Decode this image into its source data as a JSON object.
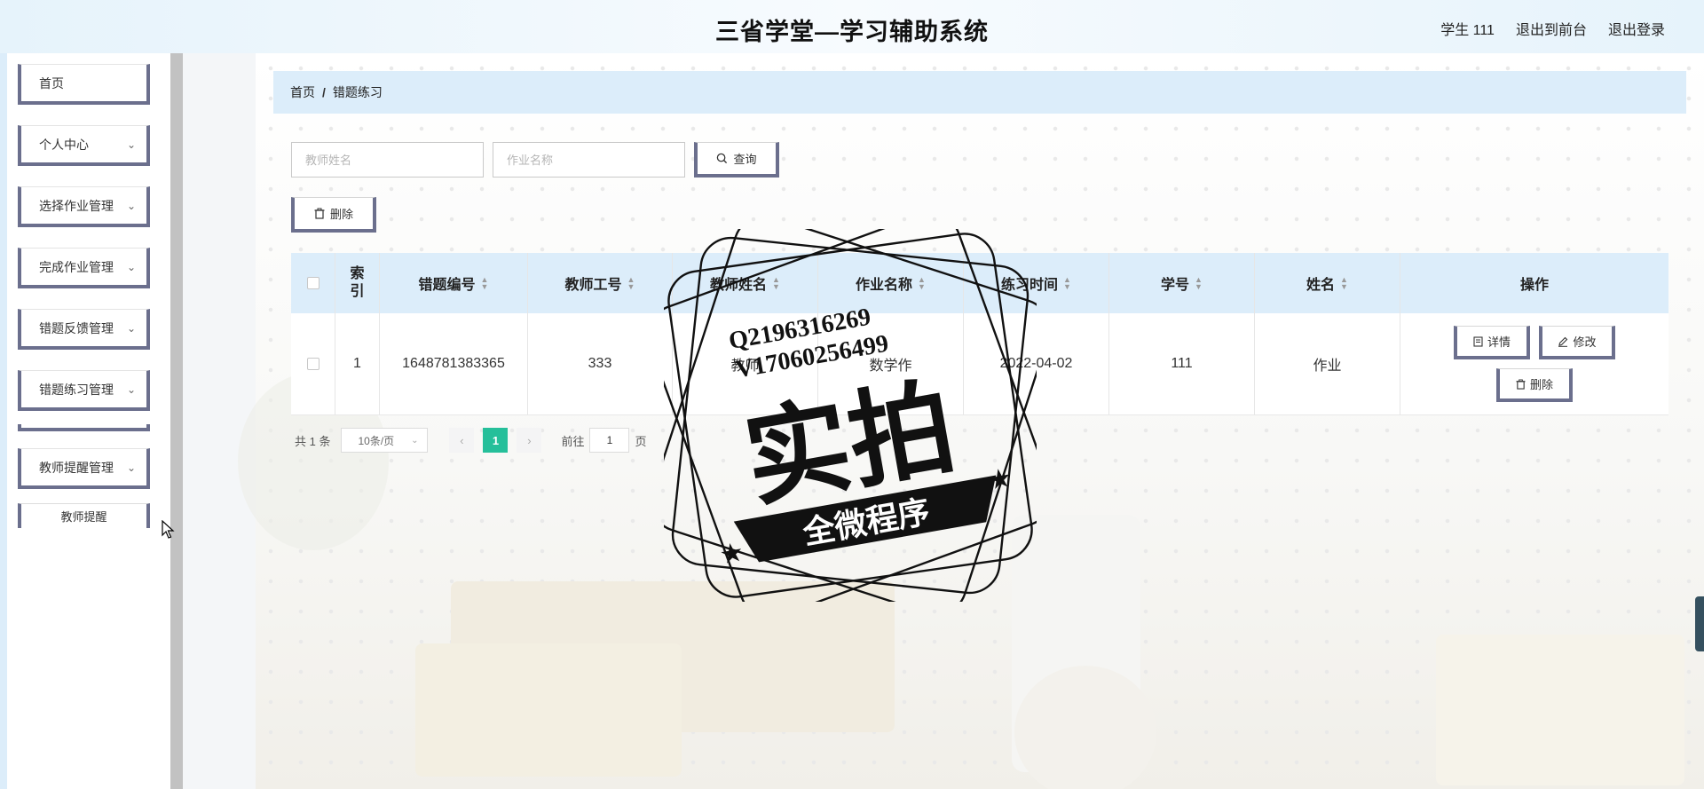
{
  "header": {
    "title": "三省学堂—学习辅助系统",
    "user": "学生 111",
    "to_front": "退出到前台",
    "logout": "退出登录"
  },
  "sidebar": {
    "items": [
      {
        "label": "首页"
      },
      {
        "label": "个人中心"
      },
      {
        "label": "选择作业管理"
      },
      {
        "label": "完成作业管理"
      },
      {
        "label": "错题反馈管理"
      },
      {
        "label": "错题练习管理"
      },
      {
        "label": "教师提醒管理"
      }
    ],
    "submenu": {
      "label": "教师提醒"
    }
  },
  "breadcrumb": {
    "home": "首页",
    "separator": "/",
    "current": "错题练习"
  },
  "search": {
    "teacher_placeholder": "教师姓名",
    "homework_placeholder": "作业名称",
    "query_label": "查询"
  },
  "actions": {
    "delete_label": "删除"
  },
  "table": {
    "headers": {
      "index": "索引",
      "code": "错题编号",
      "teacher_no": "教师工号",
      "teacher_name": "教师姓名",
      "homework_name": "作业名称",
      "practice_time": "练习时间",
      "student_no": "学号",
      "name": "姓名",
      "ops": "操作"
    },
    "rows": [
      {
        "index": "1",
        "code": "1648781383365",
        "teacher_no": "333",
        "teacher_name": "教师",
        "homework_name": "数学作",
        "practice_time": "2022-04-02",
        "student_no": "111",
        "name": "作业"
      }
    ],
    "op_labels": {
      "detail": "详情",
      "edit": "修改",
      "delete": "删除"
    }
  },
  "pagination": {
    "total": "共 1 条",
    "page_size": "10条/页",
    "current_page": "1",
    "goto_label": "前往",
    "goto_value": "1",
    "page_unit": "页"
  },
  "watermark": {
    "qq": "Q2196316269",
    "v": "V17060256499",
    "main": "实拍",
    "banner": "全微程序"
  }
}
